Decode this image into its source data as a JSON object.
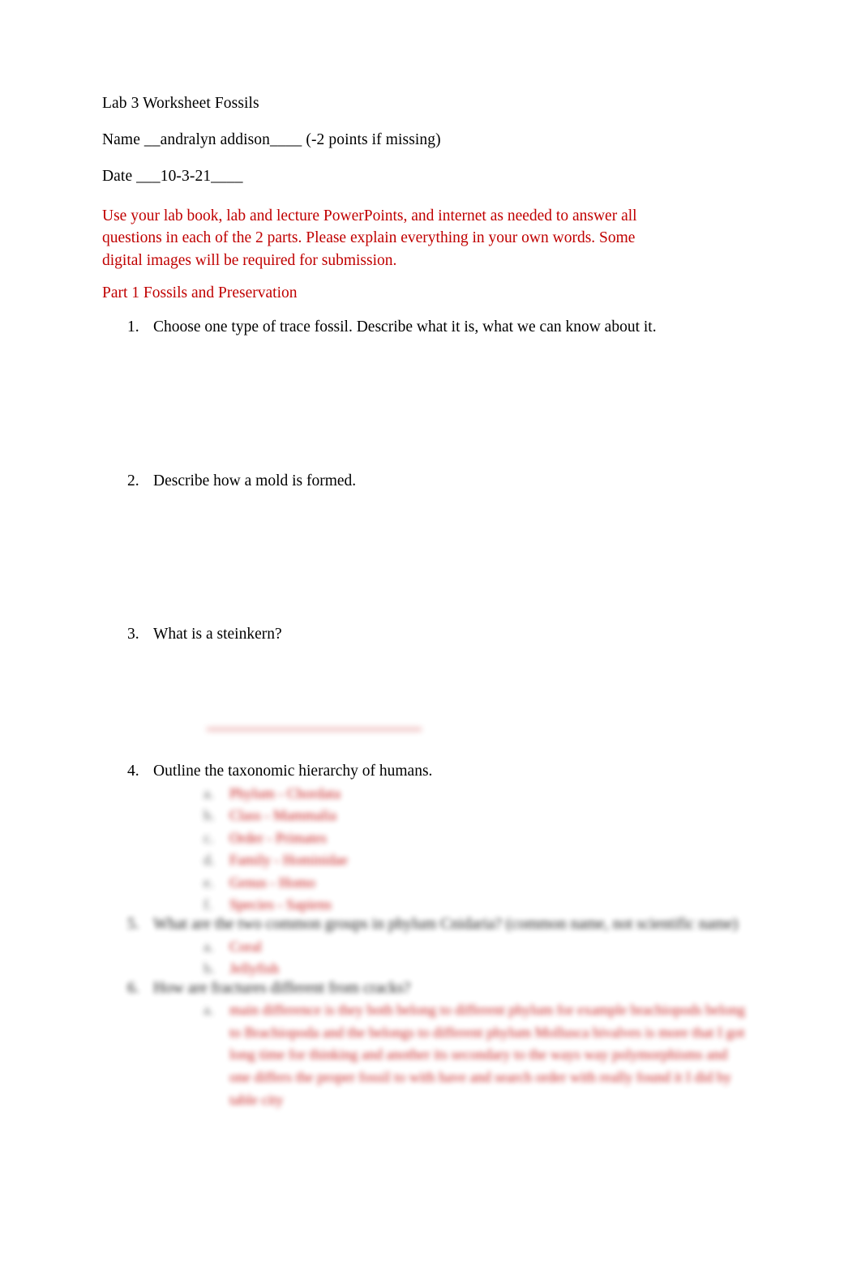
{
  "document": {
    "title": "Lab 3 Worksheet Fossils",
    "name_line": "Name __andralyn addison____  (-2 points if missing)",
    "date_line": "Date ___10-3-21____",
    "instructions": "Use your lab book, lab and lecture PowerPoints, and internet as needed to answer all questions in each of the 2 parts. Please explain everything in your own words. Some digital images will be required for submission.",
    "part_heading": "Part 1 Fossils and Preservation"
  },
  "colors": {
    "accent_red": "#C00000",
    "page_background": "#FFFFFF",
    "body_text": "#000000",
    "sub_marker": "#555555"
  },
  "questions": [
    {
      "number": "1.",
      "text": "Choose one type of trace fossil. Describe what it is, what we can know about it."
    },
    {
      "number": "2.",
      "text": "Describe how a mold is formed."
    },
    {
      "number": "3.",
      "text": "What is a steinkern?"
    },
    {
      "number": "4.",
      "text": "Outline the taxonomic hierarchy of humans.",
      "answers": [
        "Phylum - Chordata",
        "Class - Mammalia",
        "Order - Primates",
        "Family - Hominidae",
        "Genus - Homo",
        "Species - Sapiens"
      ]
    },
    {
      "number": "5.",
      "text": "What are the two common groups in phylum Cnidaria? (common name, not scientific name)",
      "answers": [
        "Coral",
        "Jellyfish"
      ]
    },
    {
      "number": "6.",
      "text": "How are fractures different from cracks?",
      "answers": [
        "main difference is they both belong to different phylum for example brachiopods belong to Brachiopoda and the belongs to  different phylum Mollusca bivalves is more that I got long time for thinking and another its secondary to the ways way polymorphisms and one differs the proper fossil to with have and search order with really found it I did by table city"
      ]
    }
  ]
}
